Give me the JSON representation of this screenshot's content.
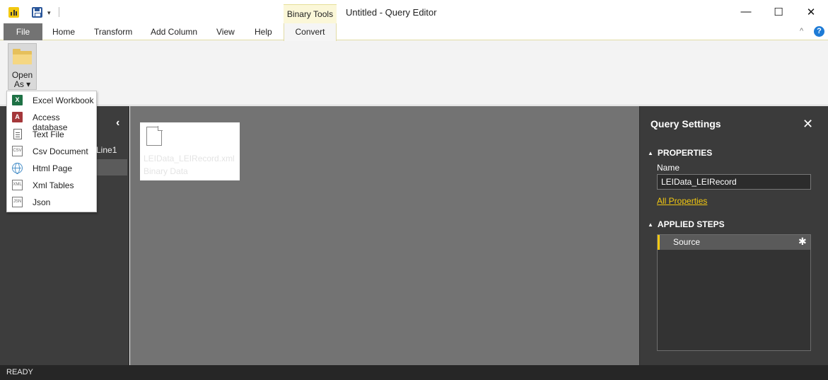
{
  "window": {
    "title": "Untitled - Query Editor",
    "contextual_group": "Binary Tools",
    "controls": {
      "minimize": "—",
      "maximize": "☐",
      "close": "✕"
    }
  },
  "quick_access": {
    "dropdown_glyph": "▾"
  },
  "ribbon": {
    "tabs": [
      {
        "label": "File"
      },
      {
        "label": "Home"
      },
      {
        "label": "Transform"
      },
      {
        "label": "Add Column"
      },
      {
        "label": "View"
      },
      {
        "label": "Help"
      },
      {
        "label": "Convert"
      }
    ],
    "active_tab": "Convert",
    "minimize_glyph": "^",
    "help_glyph": "?",
    "open_as": {
      "line1": "Open",
      "line2": "As ▾"
    }
  },
  "open_as_menu": {
    "items": [
      {
        "label": "Excel Workbook",
        "icon": "excel-icon",
        "glyph": "X"
      },
      {
        "label": "Access database",
        "icon": "access-icon",
        "glyph": "A"
      },
      {
        "label": "Text File",
        "icon": "text-file-icon"
      },
      {
        "label": "Csv Document",
        "icon": "csv-icon",
        "glyph": "CSV"
      },
      {
        "label": "Html Page",
        "icon": "globe-icon"
      },
      {
        "label": "Xml Tables",
        "icon": "xml-icon",
        "glyph": "XML"
      },
      {
        "label": "Json",
        "icon": "json-icon",
        "glyph": "JSN"
      }
    ]
  },
  "queries_pane": {
    "collapse_glyph": "‹",
    "items": [
      {
        "label": "Line1"
      }
    ]
  },
  "preview": {
    "card_lines": [
      "LEIData_LEIRecord.xml",
      "Binary Data"
    ]
  },
  "query_settings": {
    "title": "Query Settings",
    "close_glyph": "✕",
    "properties": {
      "heading": "PROPERTIES",
      "name_label": "Name",
      "name_value": "LEIData_LEIRecord",
      "all_properties_link": "All Properties"
    },
    "applied_steps": {
      "heading": "APPLIED STEPS",
      "steps": [
        {
          "label": "Source"
        }
      ],
      "gear_glyph": "✱"
    }
  },
  "status": {
    "text": "READY"
  },
  "colors": {
    "accent": "#f2c811",
    "dark_pane": "#3d3d3d",
    "center_bg": "#737373",
    "file_tab": "#737373",
    "contextual_bg": "#fbf7d8"
  }
}
